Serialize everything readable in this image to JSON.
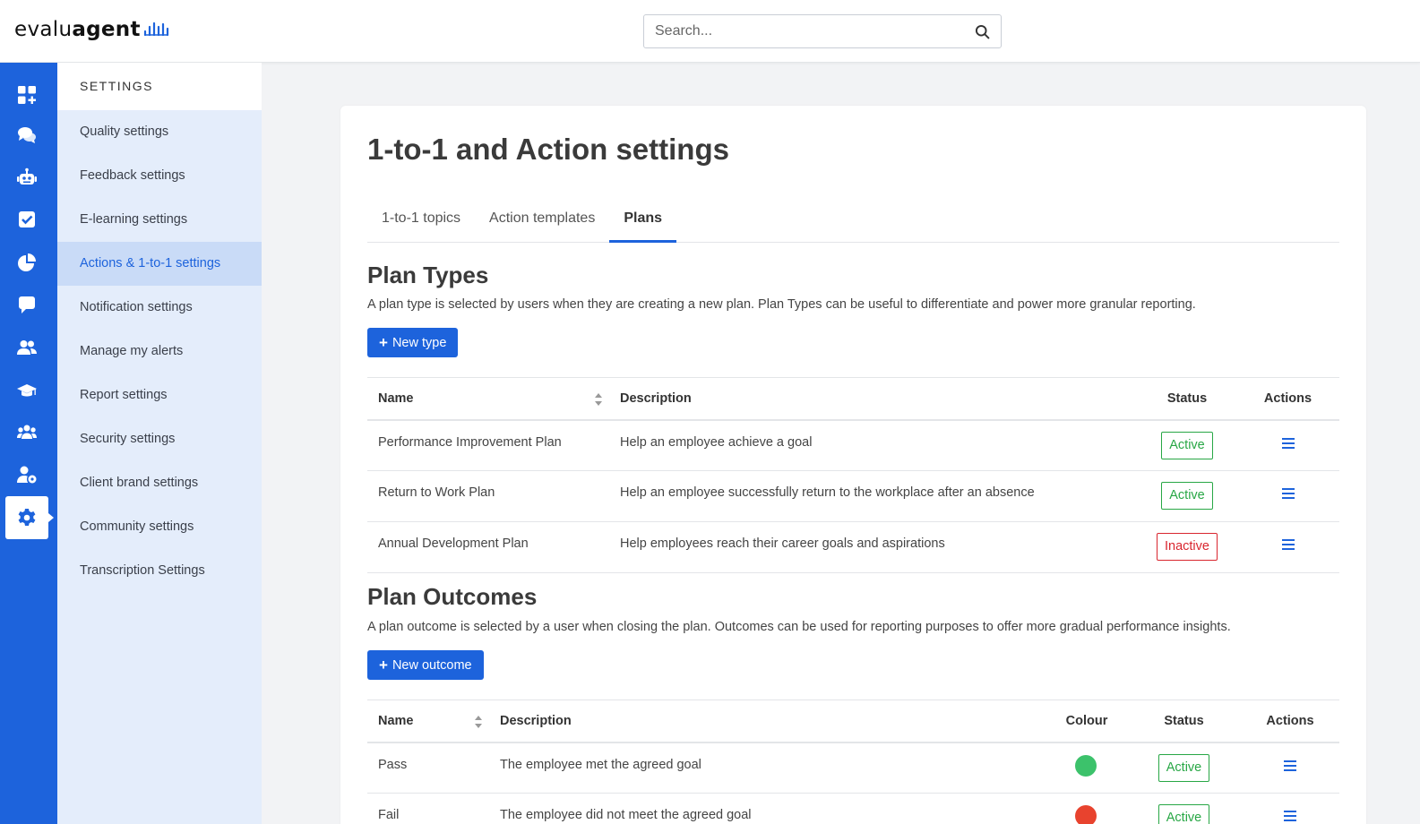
{
  "app": {
    "logo_part1": "evalu",
    "logo_part2": "agent"
  },
  "search": {
    "placeholder": "Search..."
  },
  "rail": {
    "icons": [
      "dashboard-icon",
      "conversations-icon",
      "robot-icon",
      "checkbox-icon",
      "pie-chart-icon",
      "chat-icon",
      "users-icon",
      "graduation-cap-icon",
      "team-icon",
      "user-settings-icon",
      "settings-gear-icon"
    ],
    "active_icon": "settings-gear-icon"
  },
  "panel": {
    "heading": "SETTINGS",
    "items": [
      {
        "label": "Quality settings"
      },
      {
        "label": "Feedback settings"
      },
      {
        "label": "E-learning settings"
      },
      {
        "label": "Actions & 1-to-1 settings",
        "active": true
      },
      {
        "label": "Notification settings"
      },
      {
        "label": "Manage my alerts"
      },
      {
        "label": "Report settings"
      },
      {
        "label": "Security settings"
      },
      {
        "label": "Client brand settings"
      },
      {
        "label": "Community settings"
      },
      {
        "label": "Transcription Settings"
      }
    ]
  },
  "page": {
    "title": "1-to-1 and Action settings",
    "tabs": [
      {
        "label": "1-to-1 topics"
      },
      {
        "label": "Action templates"
      },
      {
        "label": "Plans",
        "active": true
      }
    ]
  },
  "plan_types": {
    "title": "Plan Types",
    "description": "A plan type is selected by users when they are creating a new plan. Plan Types can be useful to differentiate and power more granular reporting.",
    "new_button": "New type",
    "columns": {
      "name": "Name",
      "description": "Description",
      "status": "Status",
      "actions": "Actions"
    },
    "rows": [
      {
        "name": "Performance Improvement Plan",
        "description": "Help an employee achieve a goal",
        "status": "Active"
      },
      {
        "name": "Return to Work Plan",
        "description": "Help an employee successfully return to the workplace after an absence",
        "status": "Active"
      },
      {
        "name": "Annual Development Plan",
        "description": "Help employees reach their career goals and aspirations",
        "status": "Inactive"
      }
    ]
  },
  "plan_outcomes": {
    "title": "Plan Outcomes",
    "description": "A plan outcome is selected by a user when closing the plan. Outcomes can be used for reporting purposes to offer more gradual performance insights.",
    "new_button": "New outcome",
    "columns": {
      "name": "Name",
      "description": "Description",
      "colour": "Colour",
      "status": "Status",
      "actions": "Actions"
    },
    "rows": [
      {
        "name": "Pass",
        "description": "The employee met the agreed goal",
        "colour": "#3cc26b",
        "status": "Active"
      },
      {
        "name": "Fail",
        "description": "The employee did not meet the agreed goal",
        "colour": "#e8432e",
        "status": "Active"
      }
    ]
  },
  "colors": {
    "brand": "#1d63dc",
    "active": "#28a745",
    "inactive": "#d9262f"
  }
}
